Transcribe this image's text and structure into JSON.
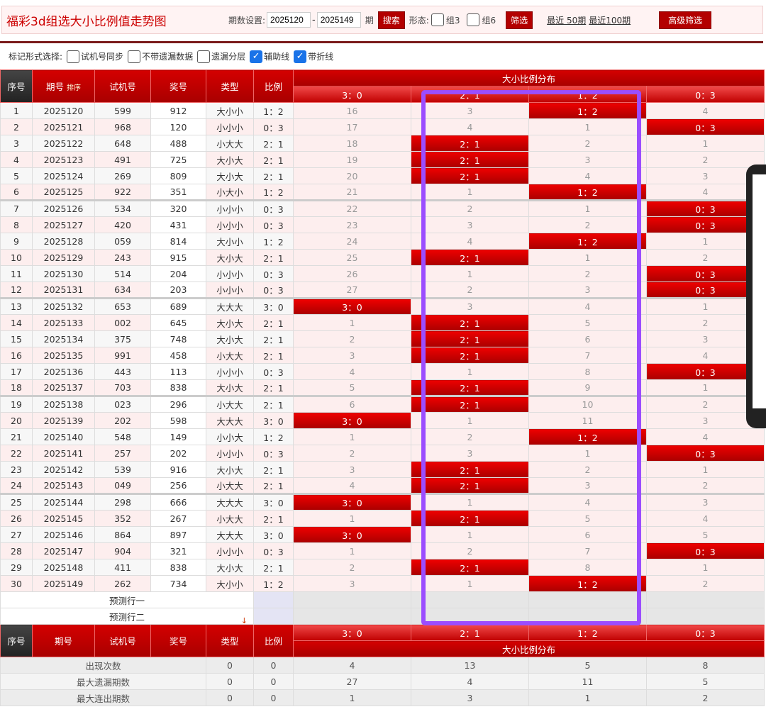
{
  "header": {
    "title": "福彩3d组选大小比例值走势图",
    "period_label": "期数设置:",
    "from": "2025120",
    "dash": "-",
    "to": "2025149",
    "period_unit": "期",
    "search": "搜索",
    "form_label": "形态:",
    "group3": "组3",
    "group6": "组6",
    "filter": "筛选",
    "recent50": "最近 50期",
    "recent100": "最近100期",
    "advanced": "高级筛选"
  },
  "toolbar": {
    "label": "标记形式选择:",
    "options": [
      {
        "label": "试机号同步",
        "checked": false
      },
      {
        "label": "不带遗漏数据",
        "checked": false
      },
      {
        "label": "遗漏分层",
        "checked": false
      },
      {
        "label": "辅助线",
        "checked": true
      },
      {
        "label": "带折线",
        "checked": true
      }
    ]
  },
  "table": {
    "headers": {
      "seq": "序号",
      "period": "期号",
      "sort": "排序",
      "test": "试机号",
      "draw": "奖号",
      "type": "类型",
      "ratio": "比例",
      "dist": "大小比例分布"
    },
    "dist_cols": [
      "3：0",
      "2：1",
      "1：2",
      "0：3"
    ],
    "rows": [
      [
        "1",
        "2025120",
        "599",
        "912",
        "大小小",
        "1：2",
        "16",
        "3",
        "1：2",
        "4"
      ],
      [
        "2",
        "2025121",
        "968",
        "120",
        "小小小",
        "0：3",
        "17",
        "4",
        "1",
        "0：3"
      ],
      [
        "3",
        "2025122",
        "648",
        "488",
        "小大大",
        "2：1",
        "18",
        "2：1",
        "2",
        "1"
      ],
      [
        "4",
        "2025123",
        "491",
        "725",
        "大小大",
        "2：1",
        "19",
        "2：1",
        "3",
        "2"
      ],
      [
        "5",
        "2025124",
        "269",
        "809",
        "大小大",
        "2：1",
        "20",
        "2：1",
        "4",
        "3"
      ],
      [
        "6",
        "2025125",
        "922",
        "351",
        "小大小",
        "1：2",
        "21",
        "1",
        "1：2",
        "4"
      ],
      [
        "7",
        "2025126",
        "534",
        "320",
        "小小小",
        "0：3",
        "22",
        "2",
        "1",
        "0：3"
      ],
      [
        "8",
        "2025127",
        "420",
        "431",
        "小小小",
        "0：3",
        "23",
        "3",
        "2",
        "0：3"
      ],
      [
        "9",
        "2025128",
        "059",
        "814",
        "大小小",
        "1：2",
        "24",
        "4",
        "1：2",
        "1"
      ],
      [
        "10",
        "2025129",
        "243",
        "915",
        "大小大",
        "2：1",
        "25",
        "2：1",
        "1",
        "2"
      ],
      [
        "11",
        "2025130",
        "514",
        "204",
        "小小小",
        "0：3",
        "26",
        "1",
        "2",
        "0：3"
      ],
      [
        "12",
        "2025131",
        "634",
        "203",
        "小小小",
        "0：3",
        "27",
        "2",
        "3",
        "0：3"
      ],
      [
        "13",
        "2025132",
        "653",
        "689",
        "大大大",
        "3：0",
        "3：0",
        "3",
        "4",
        "1"
      ],
      [
        "14",
        "2025133",
        "002",
        "645",
        "大小大",
        "2：1",
        "1",
        "2：1",
        "5",
        "2"
      ],
      [
        "15",
        "2025134",
        "375",
        "748",
        "大小大",
        "2：1",
        "2",
        "2：1",
        "6",
        "3"
      ],
      [
        "16",
        "2025135",
        "991",
        "458",
        "小大大",
        "2：1",
        "3",
        "2：1",
        "7",
        "4"
      ],
      [
        "17",
        "2025136",
        "443",
        "113",
        "小小小",
        "0：3",
        "4",
        "1",
        "8",
        "0：3"
      ],
      [
        "18",
        "2025137",
        "703",
        "838",
        "大小大",
        "2：1",
        "5",
        "2：1",
        "9",
        "1"
      ],
      [
        "19",
        "2025138",
        "023",
        "296",
        "小大大",
        "2：1",
        "6",
        "2：1",
        "10",
        "2"
      ],
      [
        "20",
        "2025139",
        "202",
        "598",
        "大大大",
        "3：0",
        "3：0",
        "1",
        "11",
        "3"
      ],
      [
        "21",
        "2025140",
        "548",
        "149",
        "小小大",
        "1：2",
        "1",
        "2",
        "1：2",
        "4"
      ],
      [
        "22",
        "2025141",
        "257",
        "202",
        "小小小",
        "0：3",
        "2",
        "3",
        "1",
        "0：3"
      ],
      [
        "23",
        "2025142",
        "539",
        "916",
        "大小大",
        "2：1",
        "3",
        "2：1",
        "2",
        "1"
      ],
      [
        "24",
        "2025143",
        "049",
        "256",
        "小大大",
        "2：1",
        "4",
        "2：1",
        "3",
        "2"
      ],
      [
        "25",
        "2025144",
        "298",
        "666",
        "大大大",
        "3：0",
        "3：0",
        "1",
        "4",
        "3"
      ],
      [
        "26",
        "2025145",
        "352",
        "267",
        "小大大",
        "2：1",
        "1",
        "2：1",
        "5",
        "4"
      ],
      [
        "27",
        "2025146",
        "864",
        "897",
        "大大大",
        "3：0",
        "3：0",
        "1",
        "6",
        "5"
      ],
      [
        "28",
        "2025147",
        "904",
        "321",
        "小小小",
        "0：3",
        "1",
        "2",
        "7",
        "0：3"
      ],
      [
        "29",
        "2025148",
        "411",
        "838",
        "大小大",
        "2：1",
        "2",
        "2：1",
        "8",
        "1"
      ],
      [
        "30",
        "2025149",
        "262",
        "734",
        "大小小",
        "1：2",
        "3",
        "1",
        "1：2",
        "2"
      ]
    ],
    "predict": [
      "预测行一",
      "预测行二"
    ],
    "stats": [
      [
        "出现次数",
        "0",
        "0",
        "4",
        "13",
        "5",
        "8"
      ],
      [
        "最大遗漏期数",
        "0",
        "0",
        "27",
        "4",
        "11",
        "5"
      ],
      [
        "最大连出期数",
        "0",
        "0",
        "1",
        "3",
        "1",
        "2"
      ]
    ]
  },
  "colors": {
    "accent": "#c00000",
    "highlight": "#9b4dff"
  }
}
